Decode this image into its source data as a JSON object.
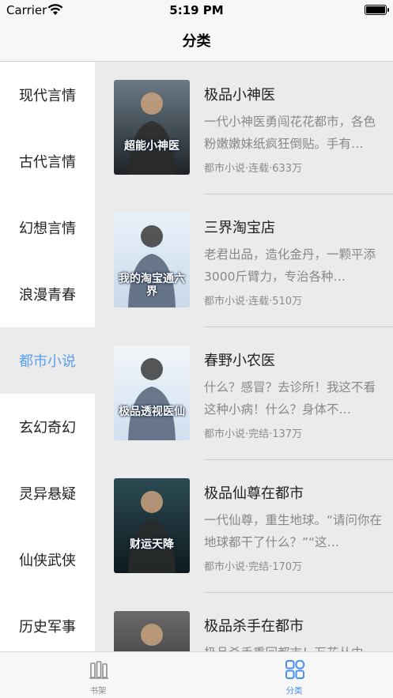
{
  "status_bar": {
    "carrier": "Carrier",
    "time": "5:19 PM"
  },
  "nav": {
    "title": "分类"
  },
  "categories": [
    {
      "label": "现代言情",
      "active": false
    },
    {
      "label": "古代言情",
      "active": false
    },
    {
      "label": "幻想言情",
      "active": false
    },
    {
      "label": "浪漫青春",
      "active": false
    },
    {
      "label": "都市小说",
      "active": true
    },
    {
      "label": "玄幻奇幻",
      "active": false
    },
    {
      "label": "灵异悬疑",
      "active": false
    },
    {
      "label": "仙侠武侠",
      "active": false
    },
    {
      "label": "历史军事",
      "active": false
    }
  ],
  "books": [
    {
      "title": "极品小神医",
      "desc": "一代小神医勇闯花花都市，各色粉嫩嫩妹纸疯狂倒贴。手有…",
      "meta": "都市小说·连载·633万",
      "cover_text": "超能小神医",
      "cover_colors": [
        "#6b7a86",
        "#1e2328"
      ]
    },
    {
      "title": "三界淘宝店",
      "desc": "老君出品，造化金丹，一颗平添3000斤臂力，专治各种…",
      "meta": "都市小说·连载·510万",
      "cover_text": "我的淘宝通六界",
      "cover_colors": [
        "#eaf2f9",
        "#c8d9ea"
      ]
    },
    {
      "title": "春野小农医",
      "desc": "什么？感冒？去诊所！我这不看这种小病！什么？身体不…",
      "meta": "都市小说·完结·137万",
      "cover_text": "极品透视医仙",
      "cover_colors": [
        "#f3f6fa",
        "#cfe0f0"
      ]
    },
    {
      "title": "极品仙尊在都市",
      "desc": "一代仙尊，重生地球。“请问你在地球都干了什么？”“这…",
      "meta": "都市小说·完结·170万",
      "cover_text": "财运天降",
      "cover_colors": [
        "#2b4a52",
        "#0f1a1e"
      ]
    },
    {
      "title": "极品杀手在都市",
      "desc": "极品杀手重回都市！万花丛中…",
      "meta": "",
      "cover_text": "",
      "cover_colors": [
        "#6a6a6a",
        "#2a2a2a"
      ]
    }
  ],
  "tabs": [
    {
      "label": "书架",
      "icon": "bookshelf-icon"
    },
    {
      "label": "分类",
      "icon": "category-grid-icon"
    }
  ],
  "colors": {
    "accent": "#4a8ff0",
    "active_category": "#5aa0f0"
  }
}
